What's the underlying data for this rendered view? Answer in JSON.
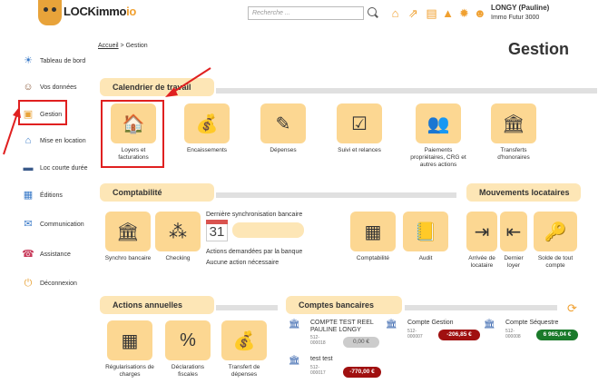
{
  "header": {
    "logo_text": "LOCKimmo",
    "logo_accent": "io",
    "search_placeholder": "Recherche ...",
    "icons": [
      "home-icon",
      "external-link-icon",
      "document-icon",
      "bell-icon",
      "gear-icon",
      "users-icon"
    ],
    "user_name": "LONGY (Pauline)",
    "agency": "Immo Futur 3000"
  },
  "sidebar": {
    "items": [
      {
        "label": "Tableau de bord",
        "icon": "dashboard-icon"
      },
      {
        "label": "Vos données",
        "icon": "user-icon"
      },
      {
        "label": "Gestion",
        "icon": "gestion-icon"
      },
      {
        "label": "Mise en location",
        "icon": "rental-icon"
      },
      {
        "label": "Loc courte durée",
        "icon": "bed-icon"
      },
      {
        "label": "Éditions",
        "icon": "editions-icon"
      },
      {
        "label": "Communication",
        "icon": "communication-icon"
      },
      {
        "label": "Assistance",
        "icon": "assistance-icon"
      },
      {
        "label": "Déconnexion",
        "icon": "logout-icon"
      }
    ]
  },
  "breadcrumb": {
    "home": "Accueil",
    "sep": ">",
    "current": "Gestion"
  },
  "page_title": "Gestion",
  "calendrier": {
    "title": "Calendrier de travail",
    "tiles": [
      {
        "label": "Loyers et facturations"
      },
      {
        "label": "Encaissements"
      },
      {
        "label": "Dépenses"
      },
      {
        "label": "Suivi et relances"
      },
      {
        "label": "Paiements propriétaires, CRG et autres actions"
      },
      {
        "label": "Transferts d'honoraires"
      }
    ]
  },
  "comptabilite": {
    "title": "Comptabilité",
    "tiles": [
      {
        "label": "Synchro bancaire"
      },
      {
        "label": "Checking"
      },
      {
        "label": "Comptabilité"
      },
      {
        "label": "Audit"
      }
    ],
    "sync_label": "Dernière synchronisation bancaire",
    "calendar_day": "31",
    "actions_label": "Actions demandées par la banque",
    "actions_none": "Aucune action nécessaire"
  },
  "mouvements": {
    "title": "Mouvements locataires",
    "tiles": [
      {
        "label": "Arrivée de locataire"
      },
      {
        "label": "Dernier loyer"
      },
      {
        "label": "Solde de tout compte"
      }
    ]
  },
  "actions_annuelles": {
    "title": "Actions annuelles",
    "tiles": [
      {
        "label": "Régularisations de charges"
      },
      {
        "label": "Déclarations fiscales"
      },
      {
        "label": "Transfert de dépenses"
      }
    ]
  },
  "comptes": {
    "title": "Comptes bancaires",
    "accounts": [
      {
        "name": "COMPTE TEST REEL PAULINE LONGY",
        "number": "512-000018",
        "balance": "0,00 €"
      },
      {
        "name": "Compte Gestion",
        "number": "512-000007",
        "balance": "-206,85 €"
      },
      {
        "name": "Compte Séquestre",
        "number": "512-000008",
        "balance": "6 965,04 €"
      },
      {
        "name": "test test",
        "number": "512-000017",
        "balance": "-770,00 €"
      }
    ]
  },
  "colors": {
    "accent": "#f0a030",
    "tile_bg": "#fcd792",
    "tab_bg": "#fde6b6",
    "highlight": "#e02020"
  }
}
